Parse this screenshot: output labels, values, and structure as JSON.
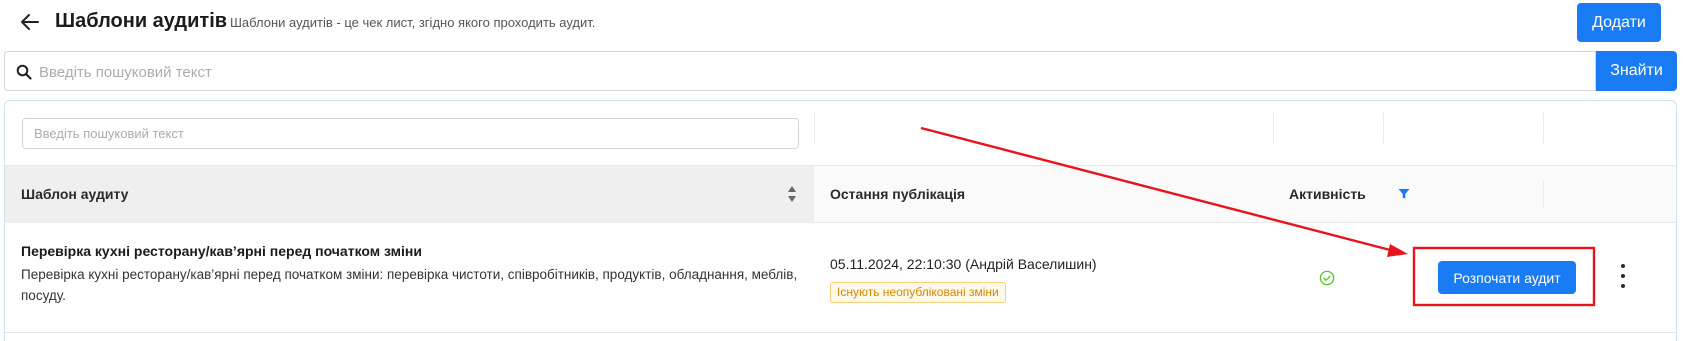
{
  "header": {
    "title": "Шаблони аудитів",
    "subtitle": "Шаблони аудитів - це чек лист, згідно якого проходить аудит.",
    "add_label": "Додати"
  },
  "search": {
    "placeholder": "Введіть пошуковий текст",
    "button_label": "Знайти"
  },
  "table": {
    "filter_placeholder": "Введіть пошуковий текст",
    "columns": {
      "template": "Шаблон аудиту",
      "last_publication": "Остання публікація",
      "activity": "Активність"
    },
    "rows": [
      {
        "name": "Перевірка кухні ресторану/кав’ярні перед початком зміни",
        "description": "Перевірка кухні ресторану/кав’ярні перед початком зміни: перевірка чистоти, співробітників, продуктів, обладнання, меблів, посуду.",
        "published": "05.11.2024, 22:10:30 (Андрій Васелишин)",
        "badge": "Існують неопубліковані зміни",
        "active": true,
        "action_label": "Розпочати аудит"
      }
    ]
  },
  "colors": {
    "primary": "#1a7cf5",
    "success": "#52c41a",
    "warning_text": "#d4860a",
    "annotation": "#e8141b"
  },
  "icons": {
    "back": "arrow-left-icon",
    "search": "search-icon",
    "sort": "sort-icon",
    "filter": "filter-icon",
    "active": "check-circle-icon",
    "more": "more-vertical-icon"
  }
}
